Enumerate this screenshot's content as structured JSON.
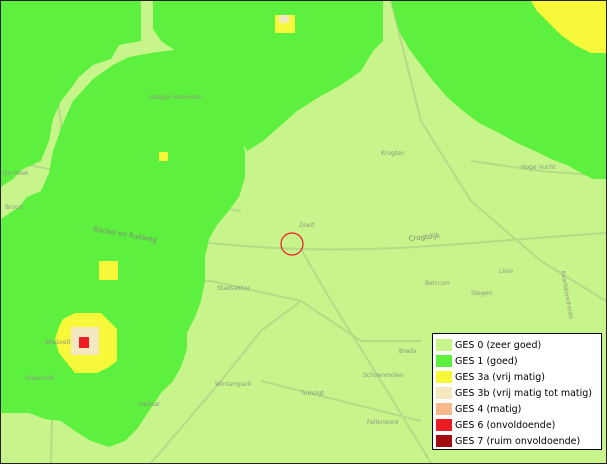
{
  "map": {
    "colors": {
      "ges0": "#c8f48c",
      "ges1": "#5ef03e",
      "ges3a": "#f8f83a",
      "ges3b": "#f4e8c0",
      "ges6": "#ee1c24",
      "roads": "#b4dc86"
    },
    "place_labels": {
      "haagse_beemden": "Haagse Beemden",
      "krogten": "Krogten",
      "hoge_vucht": "Hoge Vucht",
      "bavel_ruitweg": "Backel en Ruitweg",
      "crogtdijk": "Crogtdijk",
      "stadsakker": "Stadsakker",
      "wiesvelt": "Wiesvelt",
      "vlaarveld": "Vlaarveld",
      "linie": "Linie",
      "belcrum": "Belcrum",
      "stegen": "Stegen",
      "breda": "Breda",
      "schoenmolen": "Schoenmolen",
      "wintampark": "Wintampark",
      "tuinzigt": "Tuinzigt",
      "fellenoord": "Fellenoord",
      "heilaar": "Heilaar",
      "de_hoek": "De Hoek",
      "brood": "Brood",
      "kaarbelverheide": "Kaarbelverheide",
      "zoeit": "Zoeit"
    },
    "marker_icon": "location-circle-icon"
  },
  "legend": {
    "items": [
      {
        "label": "GES 0 (zeer goed)",
        "color": "#c8f48c"
      },
      {
        "label": "GES 1 (goed)",
        "color": "#5ef03e"
      },
      {
        "label": "GES 3a (vrij matig)",
        "color": "#f8f83a"
      },
      {
        "label": "GES 3b (vrij matig tot matig)",
        "color": "#f4e8c0"
      },
      {
        "label": "GES 4 (matig)",
        "color": "#f8b88c"
      },
      {
        "label": "GES 6 (onvoldoende)",
        "color": "#ee1c24"
      },
      {
        "label": "GES 7 (ruim onvoldoende)",
        "color": "#a00c10"
      }
    ]
  }
}
